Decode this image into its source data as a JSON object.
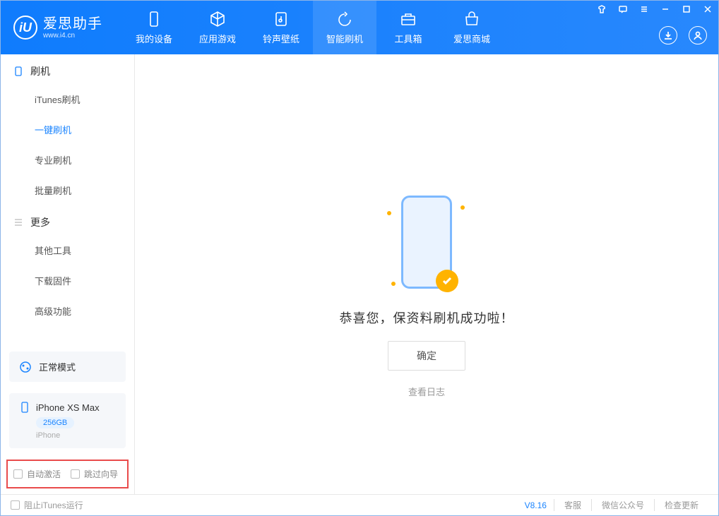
{
  "app": {
    "title": "爱思助手",
    "subtitle": "www.i4.cn"
  },
  "tabs": [
    {
      "label": "我的设备",
      "icon": "device"
    },
    {
      "label": "应用游戏",
      "icon": "cube"
    },
    {
      "label": "铃声壁纸",
      "icon": "music"
    },
    {
      "label": "智能刷机",
      "icon": "refresh",
      "active": true
    },
    {
      "label": "工具箱",
      "icon": "toolbox"
    },
    {
      "label": "爱思商城",
      "icon": "store"
    }
  ],
  "sidebar": {
    "section1": {
      "title": "刷机"
    },
    "items1": [
      {
        "label": "iTunes刷机"
      },
      {
        "label": "一键刷机",
        "active": true
      },
      {
        "label": "专业刷机"
      },
      {
        "label": "批量刷机"
      }
    ],
    "section2": {
      "title": "更多"
    },
    "items2": [
      {
        "label": "其他工具"
      },
      {
        "label": "下载固件"
      },
      {
        "label": "高级功能"
      }
    ],
    "mode": "正常模式",
    "device": {
      "name": "iPhone XS Max",
      "storage": "256GB",
      "type": "iPhone"
    },
    "opts": {
      "auto_activate": "自动激活",
      "skip_guide": "跳过向导"
    }
  },
  "main": {
    "success_text": "恭喜您，保资料刷机成功啦！",
    "ok_button": "确定",
    "log_link": "查看日志"
  },
  "footer": {
    "block_itunes": "阻止iTunes运行",
    "version": "V8.16",
    "links": [
      "客服",
      "微信公众号",
      "检查更新"
    ]
  }
}
